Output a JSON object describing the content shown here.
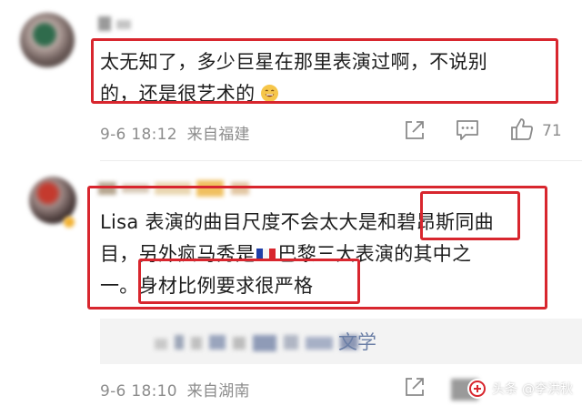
{
  "comments": [
    {
      "text_line1": "太无知了，多少巨星在那里表演过啊，不说别",
      "text_line2": "的，还是很艺术的",
      "date": "9-6",
      "time": "18:12",
      "location": "来自福建",
      "likes": "71"
    },
    {
      "line1_a": "Lisa 表演的曲目尺度不会太大是和",
      "line1_hl": "碧昂斯",
      "line1_b": "同曲",
      "line2_a": "目，另外疯马秀是",
      "line2_b": "巴黎三大表演的其中之",
      "line3_a": "一。",
      "line3_hl": "身材比例要求很严格",
      "reply_visible": "文学",
      "date": "9-6",
      "time": "18:10",
      "location": "来自湖南"
    }
  ],
  "watermark": {
    "platform": "头条",
    "author": "@李洪秋"
  },
  "colors": {
    "highlight_border": "#d8262e",
    "meta_text": "#8c8c8c"
  }
}
